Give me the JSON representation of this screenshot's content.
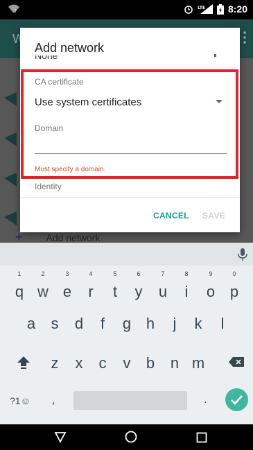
{
  "status_bar": {
    "time": "8:20",
    "wifi_icon": "wifi-question-icon",
    "alarm_icon": "alarm-icon",
    "signal_icon": "signal-lte-icon",
    "battery_icon": "battery-charging-icon"
  },
  "dialog": {
    "title": "Add network",
    "scrolled_field_value": "None",
    "ca_certificate_label": "CA certificate",
    "ca_certificate_value": "Use system certificates",
    "domain_label": "Domain",
    "domain_value": "",
    "domain_error": "Must specify a domain.",
    "identity_label": "Identity",
    "cancel_label": "CANCEL",
    "save_label": "SAVE"
  },
  "background": {
    "toolbar_letter": "W",
    "add_network_label": "Add network",
    "add_icon": "plus-icon"
  },
  "colors": {
    "accent": "#1a9a8a",
    "error": "#e64a19",
    "highlight": "#e8202a",
    "enter_key": "#3fb6a0"
  },
  "keyboard": {
    "row1": [
      {
        "key": "q",
        "hint": "1"
      },
      {
        "key": "w",
        "hint": "2"
      },
      {
        "key": "e",
        "hint": "3"
      },
      {
        "key": "r",
        "hint": "4"
      },
      {
        "key": "t",
        "hint": "5"
      },
      {
        "key": "y",
        "hint": "6"
      },
      {
        "key": "u",
        "hint": "7"
      },
      {
        "key": "i",
        "hint": "8"
      },
      {
        "key": "o",
        "hint": "9"
      },
      {
        "key": "p",
        "hint": "0"
      }
    ],
    "row2": [
      "a",
      "s",
      "d",
      "f",
      "g",
      "h",
      "j",
      "k",
      "l"
    ],
    "row3": [
      "z",
      "x",
      "c",
      "v",
      "b",
      "n",
      "m"
    ],
    "symbols_label": "?1☺",
    "comma_label": ",",
    "period_label": "."
  },
  "nav_bar": {
    "back_icon": "back-triangle-icon",
    "home_icon": "home-circle-icon",
    "recents_icon": "recents-square-icon"
  }
}
